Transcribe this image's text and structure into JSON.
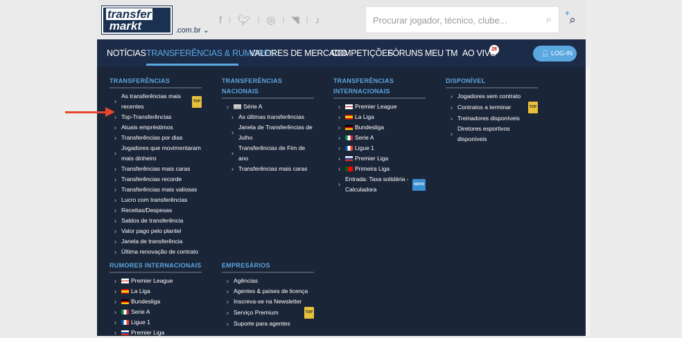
{
  "header": {
    "logo_text": "transfer markt",
    "domain": ".com.br",
    "search_placeholder": "Procurar jogador, técnico, clube...",
    "social_icons": [
      "facebook-icon",
      "twitter-icon",
      "instagram-icon",
      "rss-icon",
      "tiktok-icon"
    ]
  },
  "nav": {
    "items": [
      "NOTÍCIAS",
      "TRANSFERÊNCIAS & RUMORES",
      "VALORES DE MERCADO",
      "COMPETIÇÕES",
      "FÓRUNS",
      "MEU TM",
      "AO VIVO"
    ],
    "live_count": "28",
    "login": "LOG-IN"
  },
  "colors": {
    "nav_bg": "#1c2b47",
    "accent": "#5ba7e0",
    "dropdown_bg": "#1b2538",
    "arrow": "#e8462c"
  },
  "columns": [
    {
      "sections": [
        {
          "title": "TRANSFERÊNCIAS",
          "items": [
            {
              "label": "As transferências mais recentes",
              "tag": "TOP"
            },
            {
              "label": "Top-Transferências"
            },
            {
              "label": "Atuais empréstimos"
            },
            {
              "label": "Transferências por dias"
            },
            {
              "label": "Jogadores que movimentaram mais dinheiro"
            },
            {
              "label": "Transferências mais caras"
            },
            {
              "label": "Transferências recorde"
            },
            {
              "label": "Transferências mais valiosas"
            },
            {
              "label": "Lucro com transferências"
            },
            {
              "label": "Receitas/Despesas"
            },
            {
              "label": "Saldos de transferência"
            },
            {
              "label": "Valor pago pelo plantel"
            },
            {
              "label": "Janela de transferência"
            },
            {
              "label": "Última renovação de contrato"
            }
          ]
        },
        {
          "title": "RUMORES INTERNACIONAIS",
          "items": [
            {
              "label": "Premier League",
              "flag": "eng"
            },
            {
              "label": "La Liga",
              "flag": "es"
            },
            {
              "label": "Bundesliga",
              "flag": "de"
            },
            {
              "label": "Serie A",
              "flag": "it"
            },
            {
              "label": "Ligue 1",
              "flag": "fr"
            },
            {
              "label": "Premier Liga",
              "flag": "ru"
            }
          ]
        }
      ]
    },
    {
      "sections": [
        {
          "title": "TRANSFERÊNCIAS NACIONAIS",
          "items": [
            {
              "label": "Série A",
              "flag": "br"
            },
            {
              "label": "As últimas transferências",
              "sub": true
            },
            {
              "label": "Janela de Transferências de Julho",
              "sub": true
            },
            {
              "label": "Transferências de Fim de ano",
              "sub": true
            },
            {
              "label": "Transferências mais caras",
              "sub": true
            }
          ]
        },
        {
          "title": "EMPRESÁRIOS",
          "items": [
            {
              "label": "Agências"
            },
            {
              "label": "Agentes & países de licença"
            },
            {
              "label": "Inscreva-se na Newsletter"
            },
            {
              "label": "Serviço Premium",
              "tag": "TOP"
            },
            {
              "label": "Suporte para agentes"
            }
          ]
        }
      ]
    },
    {
      "sections": [
        {
          "title": "TRANSFERÊNCIAS INTERNACIONAIS",
          "items": [
            {
              "label": "Premier League",
              "flag": "eng"
            },
            {
              "label": "La Liga",
              "flag": "es"
            },
            {
              "label": "Bundesliga",
              "flag": "de"
            },
            {
              "label": "Serie A",
              "flag": "it"
            },
            {
              "label": "Ligue 1",
              "flag": "fr"
            },
            {
              "label": "Premier Liga",
              "flag": "ru"
            },
            {
              "label": "Primeira Liga",
              "flag": "pt"
            },
            {
              "label": "Entrada: Taxa solidária - Calculadora",
              "tag": "NOVO"
            }
          ]
        }
      ]
    },
    {
      "sections": [
        {
          "title": "DISPONÍVEL",
          "items": [
            {
              "label": "Jogadores sem contrato"
            },
            {
              "label": "Contratos a terminar",
              "tag": "TOP"
            },
            {
              "label": "Treinadores disponíveis"
            },
            {
              "label": "Diretores esportivos disponíveis"
            }
          ]
        }
      ]
    }
  ]
}
